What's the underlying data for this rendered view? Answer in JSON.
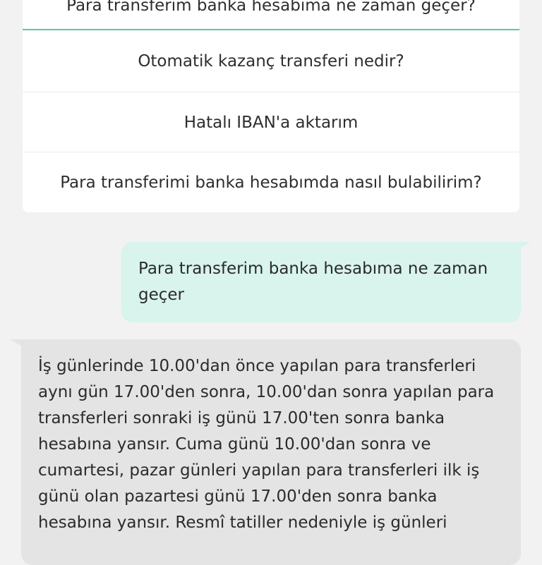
{
  "faq_options": [
    {
      "label": "Para transferim banka hesabıma ne zaman geçer?",
      "selected": true
    },
    {
      "label": "Otomatik kazanç transferi nedir?",
      "selected": false
    },
    {
      "label": "Hatalı IBAN'a aktarım",
      "selected": false
    },
    {
      "label": "Para transferimi banka hesabımda nasıl bulabilirim?",
      "selected": false
    }
  ],
  "messages": {
    "user": "Para transferim banka hesabıma ne zaman geçer",
    "bot": "İş günlerinde 10.00'dan önce yapılan para transferleri aynı gün 17.00'den sonra, 10.00'dan sonra yapılan para transferleri sonraki iş günü 17.00'ten sonra banka hesabına yansır. Cuma günü 10.00'dan sonra ve cumartesi, pazar günleri yapılan para transferleri ilk iş günü olan pazartesi günü 17.00'den sonra banka hesabına yansır. Resmî tatiller nedeniyle iş günleri"
  },
  "colors": {
    "selected_border": "#5cc8a8",
    "user_bubble": "#d8f4ec",
    "bot_bubble": "#e4e4e4",
    "background": "#f2f2f2"
  }
}
